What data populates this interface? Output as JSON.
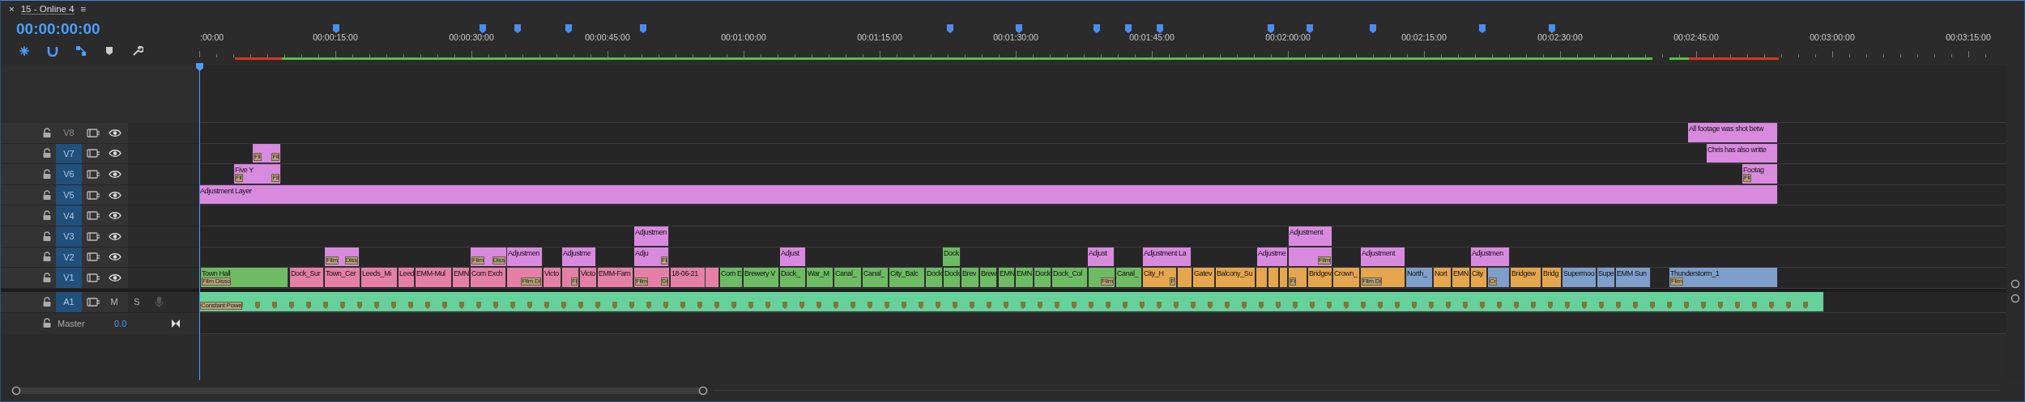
{
  "panel": {
    "close": "×",
    "title": "15 - Online 4",
    "menu": "≡"
  },
  "timecode": "00:00:00:00",
  "ruler": {
    "labels": [
      ":00:00",
      "00:00:15:00",
      "00:00:30:00",
      "00:00:45:00",
      "00:01:00:00",
      "00:01:15:00",
      "00:01:30:00",
      "00:01:45:00",
      "00:02:00:00",
      "00:02:15:00",
      "00:02:30:00",
      "00:02:45:00",
      "00:03:00:00",
      "00:03:15:00"
    ]
  },
  "video_tracks": [
    {
      "name": "V8",
      "targeted": false,
      "clips": [
        {
          "title": "All footage was shot betw",
          "color": "#d88ade"
        }
      ]
    },
    {
      "name": "V7",
      "targeted": true,
      "clips": [
        {
          "color": "#d88ade",
          "transitions": [
            "Fil",
            "Fil"
          ]
        },
        {
          "title": "Chris has also writte",
          "color": "#d88ade"
        }
      ]
    },
    {
      "name": "V6",
      "targeted": true,
      "clips": [
        {
          "title": "Five Y",
          "color": "#d88ade",
          "transitions": [
            "Fil",
            "Fil"
          ]
        },
        {
          "title": "Footag",
          "color": "#d88ade",
          "transitions": [
            "Fil"
          ]
        }
      ]
    },
    {
      "name": "V5",
      "targeted": true,
      "clips": [
        {
          "title": "Adjustment Layer",
          "color": "#d88ade"
        }
      ]
    },
    {
      "name": "V4",
      "targeted": true
    },
    {
      "name": "V3",
      "targeted": true,
      "clips": [
        {
          "title": "Adjustmen",
          "color": "#d88ade"
        },
        {
          "title": "Adjustment",
          "color": "#d88ade"
        }
      ]
    },
    {
      "name": "V2",
      "targeted": true,
      "clips": [
        {
          "color": "#d88ade",
          "transitions": [
            "Film",
            "Diss"
          ]
        },
        {
          "color": "#d88ade",
          "transitions": [
            "Film",
            "Diss"
          ]
        },
        {
          "title": "Adjustmen",
          "color": "#d88ade"
        },
        {
          "title": "Adjustme",
          "color": "#d88ade"
        },
        {
          "title": "Adju",
          "color": "#d88ade",
          "transitions": [
            "Fi"
          ]
        },
        {
          "title": "Adjust",
          "color": "#d88ade"
        },
        {
          "title": "Dock",
          "color": "#6dbb63"
        },
        {
          "title": "Adjust",
          "color": "#d88ade"
        },
        {
          "title": "Adjustment La",
          "color": "#d88ade"
        },
        {
          "title": "Adjustme",
          "color": "#d88ade"
        },
        {
          "color": "#d88ade",
          "transitions": [
            "Film"
          ]
        },
        {
          "title": "Adjustment",
          "color": "#d88ade"
        },
        {
          "title": "Adjustmen",
          "color": "#d88ade"
        }
      ]
    },
    {
      "name": "V1",
      "targeted": true,
      "clips": [
        {
          "title": "Town Hall",
          "color": "#6dbb63",
          "transitions": [
            "Film Disso"
          ]
        },
        {
          "title": "Dock_Sur",
          "color": "#e57fa5"
        },
        {
          "title": "Town_Cer",
          "color": "#e57fa5"
        },
        {
          "title": "Leeds_Mi",
          "color": "#e57fa5"
        },
        {
          "title": "Leed",
          "color": "#e57fa5"
        },
        {
          "title": "EMM-Mul",
          "color": "#e57fa5"
        },
        {
          "title": "EMN",
          "color": "#e57fa5"
        },
        {
          "title": "Corn Exch",
          "color": "#e57fa5"
        },
        {
          "color": "#e57fa5",
          "transitions": [
            "Film Di"
          ]
        },
        {
          "title": "Victo",
          "color": "#e57fa5"
        },
        {
          "color": "#e57fa5",
          "transitions": [
            "Fi"
          ]
        },
        {
          "title": "Victo",
          "color": "#e57fa5"
        },
        {
          "title": "EMM-Farn",
          "color": "#e57fa5"
        },
        {
          "color": "#e57fa5",
          "transitions": [
            "Film",
            "Di"
          ]
        },
        {
          "title": "18-06-21",
          "color": "#e57fa5"
        },
        {
          "color": "#e57fa5"
        },
        {
          "title": "Corn E",
          "color": "#6dbb63"
        },
        {
          "title": "Brewery V",
          "color": "#6dbb63"
        },
        {
          "title": "Dock_",
          "color": "#6dbb63"
        },
        {
          "title": "War_M",
          "color": "#6dbb63"
        },
        {
          "title": "Canal_",
          "color": "#6dbb63"
        },
        {
          "title": "Canal_",
          "color": "#6dbb63"
        },
        {
          "title": "City_Balc",
          "color": "#6dbb63"
        },
        {
          "title": "Dock",
          "color": "#6dbb63"
        },
        {
          "title": "Dock",
          "color": "#6dbb63"
        },
        {
          "title": "Brev",
          "color": "#6dbb63"
        },
        {
          "title": "Brew",
          "color": "#6dbb63"
        },
        {
          "title": "EMN",
          "color": "#6dbb63"
        },
        {
          "title": "EMN",
          "color": "#6dbb63"
        },
        {
          "title": "Dock",
          "color": "#6dbb63"
        },
        {
          "title": "Dock_Col",
          "color": "#6dbb63"
        },
        {
          "color": "#6dbb63",
          "transitions": [
            "Film"
          ]
        },
        {
          "title": "Canal_",
          "color": "#6dbb63"
        },
        {
          "title": "City_H",
          "color": "#e5a64d",
          "transitions": [
            "F"
          ]
        },
        {
          "color": "#e5a64d"
        },
        {
          "title": "Gatev",
          "color": "#e5a64d"
        },
        {
          "title": "Balcony_Su",
          "color": "#e5a64d"
        },
        {
          "color": "#e5a64d"
        },
        {
          "color": "#e5a64d"
        },
        {
          "color": "#e5a64d"
        },
        {
          "color": "#e5a64d",
          "transitions": [
            "Fi"
          ]
        },
        {
          "title": "Bridgev",
          "color": "#e5a64d"
        },
        {
          "title": "Crown_",
          "color": "#e5a64d"
        },
        {
          "color": "#e5a64d",
          "transitions": [
            "Film Di"
          ]
        },
        {
          "title": "North_",
          "color": "#7e9ecb"
        },
        {
          "title": "Nort",
          "color": "#e5a64d"
        },
        {
          "title": "EMN",
          "color": "#e5a64d"
        },
        {
          "title": "City",
          "color": "#e5a64d"
        },
        {
          "color": "#7e9ecb",
          "transitions": [
            "Cr"
          ]
        },
        {
          "title": "Bridgew",
          "color": "#e5a64d"
        },
        {
          "title": "Bridg",
          "color": "#e5a64d"
        },
        {
          "title": "Supermoo",
          "color": "#7e9ecb"
        },
        {
          "title": "Supe",
          "color": "#7e9ecb"
        },
        {
          "title": "EMM Sun",
          "color": "#7e9ecb"
        },
        {
          "title": "Thunderstorm_1",
          "color": "#7e9ecb",
          "transitions": [
            "Film"
          ]
        }
      ]
    }
  ],
  "audio_tracks": [
    {
      "name": "A1",
      "targeted": true,
      "mute": "M",
      "solo": "S",
      "clips": [
        {
          "color": "#66d19b",
          "transitions": [
            "Constant Powe"
          ]
        }
      ]
    }
  ],
  "master": {
    "name": "Master",
    "volume": "0.0"
  }
}
